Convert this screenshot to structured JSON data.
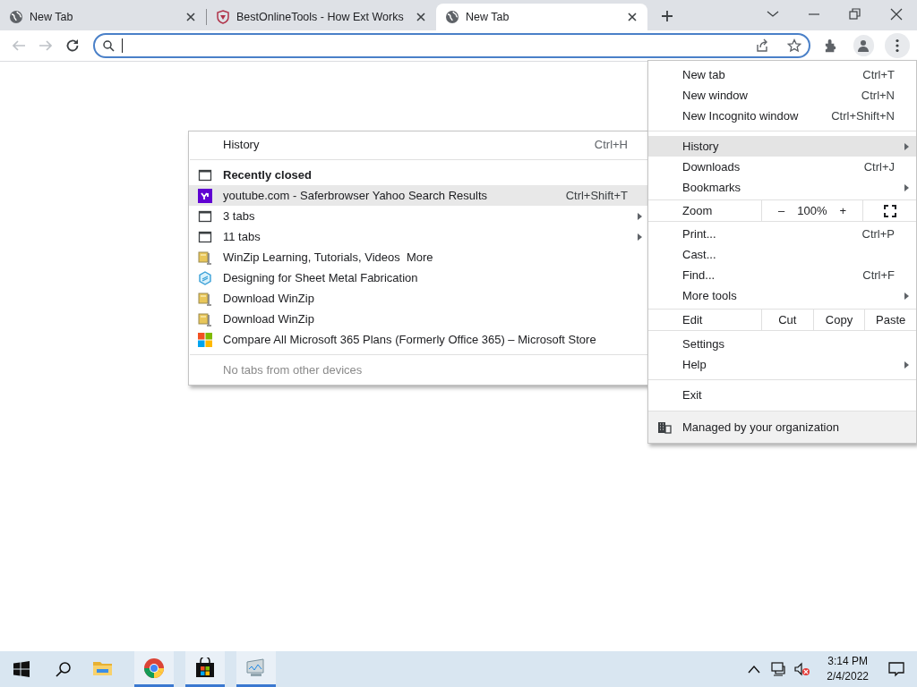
{
  "tabs": [
    {
      "title": "New Tab",
      "selected": false
    },
    {
      "title": "BestOnlineTools - How Ext Works",
      "selected": false
    },
    {
      "title": "New Tab",
      "selected": true
    }
  ],
  "history_submenu": {
    "items": [
      {
        "kind": "header",
        "label": "History",
        "shortcut": "Ctrl+H"
      },
      {
        "kind": "separator"
      },
      {
        "kind": "section",
        "label": "Recently closed"
      },
      {
        "kind": "yahoo",
        "label": "youtube.com - Saferbrowser Yahoo Search Results",
        "shortcut": "Ctrl+Shift+T",
        "submenu": false,
        "selected": true
      },
      {
        "kind": "window",
        "label": "3 tabs",
        "submenu": true,
        "selected": false
      },
      {
        "kind": "window",
        "label": "11 tabs",
        "submenu": true,
        "selected": false
      },
      {
        "kind": "archive",
        "label": "WinZip Learning, Tutorials, Videos  More",
        "submenu": false,
        "selected": false
      },
      {
        "kind": "hexagon",
        "label": "Designing for Sheet Metal Fabrication",
        "submenu": false,
        "selected": false
      },
      {
        "kind": "archive",
        "label": "Download WinZip",
        "submenu": false,
        "selected": false
      },
      {
        "kind": "archive",
        "label": "Download WinZip",
        "submenu": false,
        "selected": false
      },
      {
        "kind": "squares",
        "label": "Compare All Microsoft 365 Plans (Formerly Office 365) – Microsoft Store",
        "submenu": false,
        "selected": false
      },
      {
        "kind": "separator"
      },
      {
        "kind": "footer",
        "label": "No tabs from other devices",
        "disabled": true
      }
    ]
  },
  "main_menu": {
    "items": [
      {
        "kind": "item",
        "label": "New tab",
        "shortcut": "Ctrl+T",
        "submenu": false,
        "selected": false
      },
      {
        "kind": "item",
        "label": "New window",
        "shortcut": "Ctrl+N",
        "submenu": false,
        "selected": false
      },
      {
        "kind": "item",
        "label": "New Incognito window",
        "shortcut": "Ctrl+Shift+N",
        "submenu": false,
        "selected": false
      },
      {
        "kind": "separator"
      },
      {
        "kind": "item",
        "label": "History",
        "submenu": true,
        "selected": true
      },
      {
        "kind": "item",
        "label": "Downloads",
        "shortcut": "Ctrl+J",
        "submenu": false,
        "selected": false
      },
      {
        "kind": "item",
        "label": "Bookmarks",
        "submenu": true,
        "selected": false
      },
      {
        "kind": "zoom",
        "label": "Zoom",
        "minus": "–",
        "value": "100%",
        "plus": "+"
      },
      {
        "kind": "item",
        "label": "Print...",
        "shortcut": "Ctrl+P",
        "submenu": false,
        "selected": false
      },
      {
        "kind": "item",
        "label": "Cast...",
        "submenu": false,
        "selected": false
      },
      {
        "kind": "item",
        "label": "Find...",
        "shortcut": "Ctrl+F",
        "submenu": false,
        "selected": false
      },
      {
        "kind": "item",
        "label": "More tools",
        "submenu": true,
        "selected": false
      },
      {
        "kind": "edit",
        "label": "Edit",
        "buttons": [
          "Cut",
          "Copy",
          "Paste"
        ]
      },
      {
        "kind": "item",
        "label": "Settings",
        "submenu": false,
        "selected": false
      },
      {
        "kind": "item",
        "label": "Help",
        "submenu": true,
        "selected": false
      },
      {
        "kind": "separator"
      },
      {
        "kind": "item",
        "label": "Exit",
        "submenu": false,
        "selected": false
      },
      {
        "kind": "managed",
        "label": "Managed by your organization"
      }
    ]
  },
  "taskbar": {
    "apps": [
      {
        "running": false
      },
      {
        "running": true
      },
      {
        "running": true
      },
      {
        "running": true
      }
    ],
    "time": "3:14 PM",
    "date": "2/4/2022"
  }
}
